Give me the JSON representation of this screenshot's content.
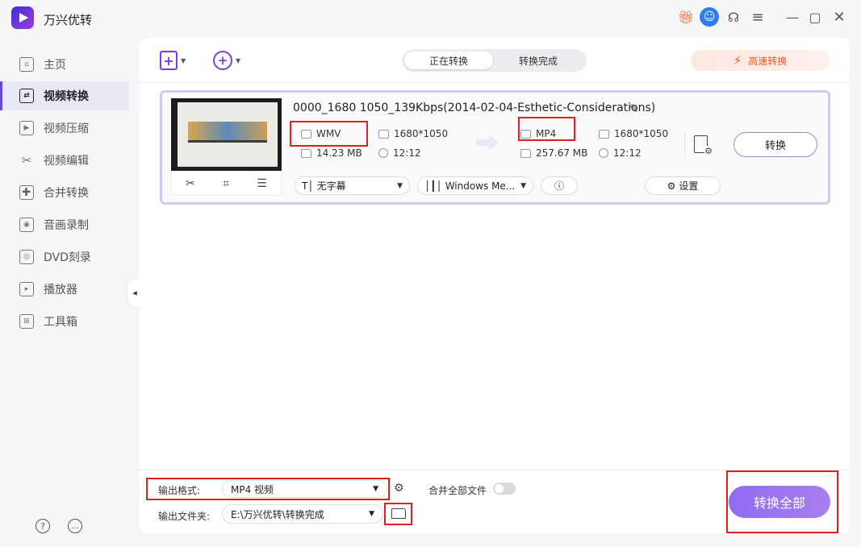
{
  "app": {
    "title": "万兴优转"
  },
  "titlebar": {
    "icons": [
      "gift-icon",
      "user-avatar-icon",
      "headset-icon",
      "menu-icon",
      "minimize-icon",
      "maximize-icon",
      "close-icon"
    ]
  },
  "sidebar": {
    "items": [
      {
        "label": "主页",
        "icon": "home-icon",
        "active": false
      },
      {
        "label": "视频转换",
        "icon": "convert-icon",
        "active": true
      },
      {
        "label": "视频压缩",
        "icon": "compress-icon",
        "active": false
      },
      {
        "label": "视频编辑",
        "icon": "scissors-icon",
        "active": false
      },
      {
        "label": "合并转换",
        "icon": "merge-icon",
        "active": false
      },
      {
        "label": "音画录制",
        "icon": "record-icon",
        "active": false
      },
      {
        "label": "DVD刻录",
        "icon": "dvd-icon",
        "active": false
      },
      {
        "label": "播放器",
        "icon": "player-icon",
        "active": false
      },
      {
        "label": "工具箱",
        "icon": "toolbox-icon",
        "active": false
      }
    ],
    "footer_icons": [
      "help-icon",
      "feedback-icon"
    ]
  },
  "toolbar": {
    "tabs": [
      "正在转换",
      "转换完成"
    ],
    "active_tab": "正在转换",
    "high_speed_label": "高速转换",
    "accent_color": "#7a3ee0",
    "high_speed_color": "#f05a23"
  },
  "file": {
    "name": "0000_1680 1050_139Kbps(2014-02-04-Esthetic-Considerations)",
    "source": {
      "format": "WMV",
      "size": "14.23 MB",
      "resolution": "1680*1050",
      "duration": "12:12"
    },
    "target": {
      "format": "MP4",
      "size": "257.67 MB",
      "resolution": "1680*1050",
      "duration": "12:12"
    },
    "convert_label": "转换",
    "subtitle": "无字幕",
    "audio": "Windows Me...",
    "settings_label": "设置"
  },
  "bottom": {
    "output_format_label": "输出格式:",
    "output_format_value": "MP4 视频",
    "merge_label": "合并全部文件",
    "merge_enabled": false,
    "output_folder_label": "输出文件夹:",
    "output_folder_value": "E:\\万兴优转\\转换完成",
    "convert_all_label": "转换全部",
    "convert_all_color": "#9a75f0"
  },
  "highlight_color": "#e01f1f"
}
